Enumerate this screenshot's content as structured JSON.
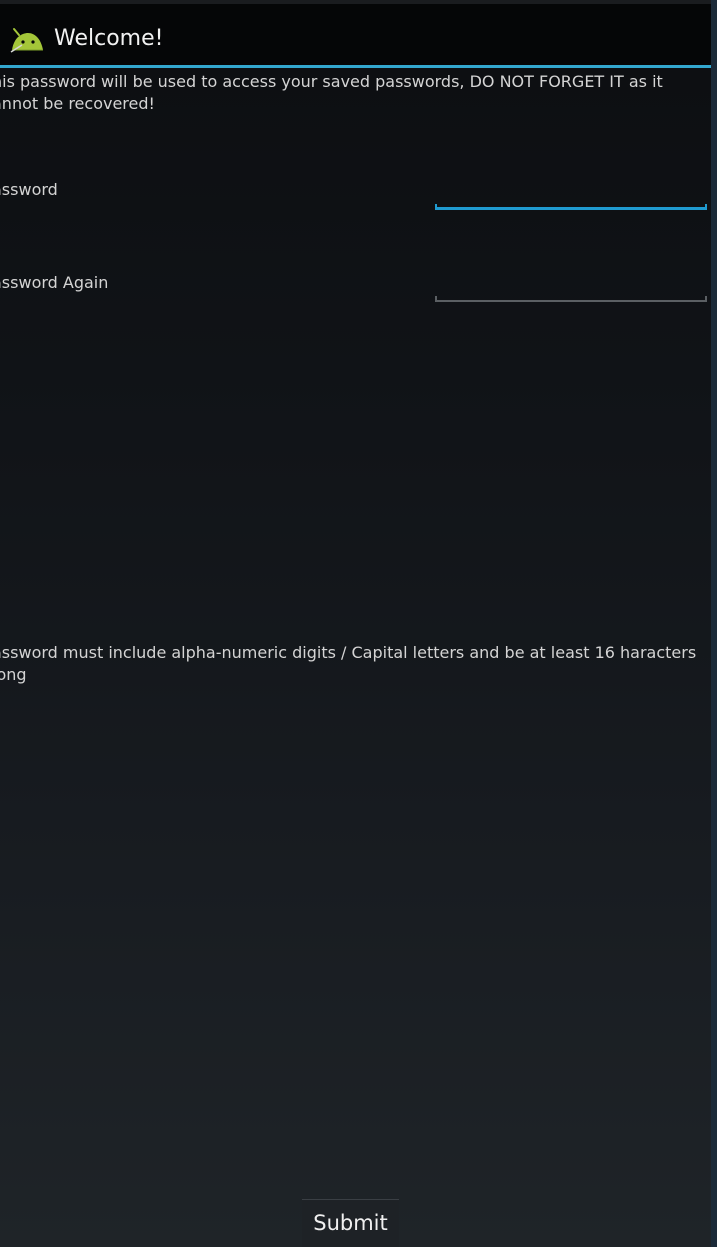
{
  "action_bar": {
    "title": "Welcome!",
    "icon": "android-icon",
    "accent_color": "#33a7cf"
  },
  "intro_text": "his password will be used to access your saved passwords, DO NOT FORGET IT as it annot be recovered!",
  "fields": {
    "password": {
      "label": "assword",
      "value": "",
      "focused": true
    },
    "password_again": {
      "label": "assword Again",
      "value": "",
      "focused": false
    }
  },
  "requirements_text": "assword must include alpha-numeric digits / Capital letters and be at least 16 haracters long",
  "submit_label": "Submit"
}
